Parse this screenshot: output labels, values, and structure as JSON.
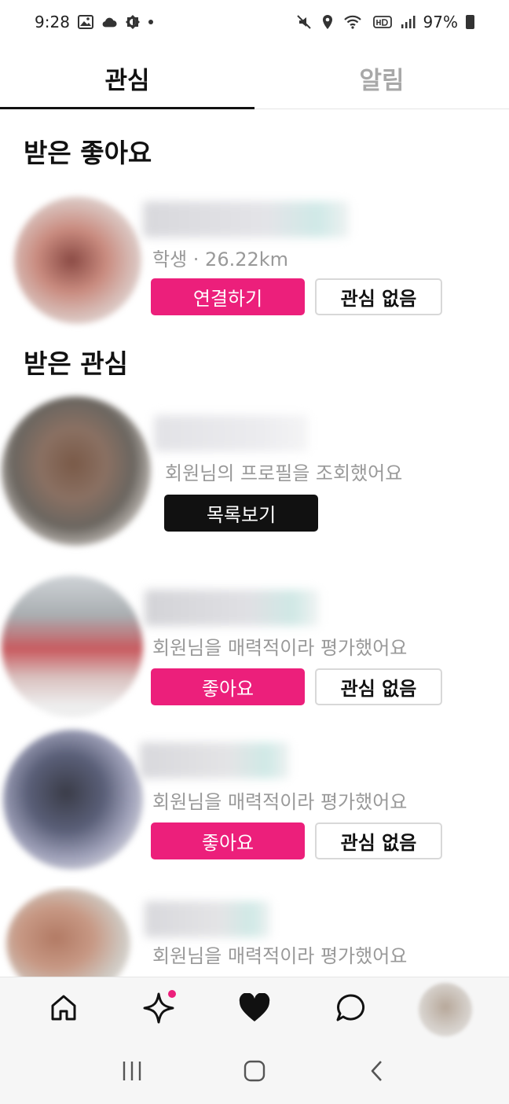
{
  "status_bar": {
    "time": "9:28",
    "battery": "97%"
  },
  "tabs": [
    {
      "label": "관심",
      "active": true
    },
    {
      "label": "알림",
      "active": false
    }
  ],
  "sections": {
    "received_likes_title": "받은 좋아요",
    "received_interest_title": "받은 관심"
  },
  "cards": {
    "like_card": {
      "meta": "학생 · 26.22km",
      "primary_label": "연결하기",
      "secondary_label": "관심 없음"
    },
    "view_card": {
      "meta": "회원님의 프로필을 조회했어요",
      "primary_label": "목록보기"
    },
    "rating_cards": [
      {
        "meta": "회원님을 매력적이라 평가했어요",
        "primary_label": "좋아요",
        "secondary_label": "관심 없음"
      },
      {
        "meta": "회원님을 매력적이라 평가했어요",
        "primary_label": "좋아요",
        "secondary_label": "관심 없음"
      },
      {
        "meta": "회원님을 매력적이라 평가했어요"
      }
    ]
  },
  "bottom_nav": {
    "items": [
      {
        "icon": "home-icon"
      },
      {
        "icon": "sparkle-icon",
        "badge": true
      },
      {
        "icon": "heart-icon",
        "active": true
      },
      {
        "icon": "chat-bubble-icon"
      },
      {
        "icon": "profile-avatar"
      }
    ]
  },
  "colors": {
    "accent_pink": "#ec1f7b",
    "black_button": "#111111",
    "muted_text": "#999999"
  }
}
